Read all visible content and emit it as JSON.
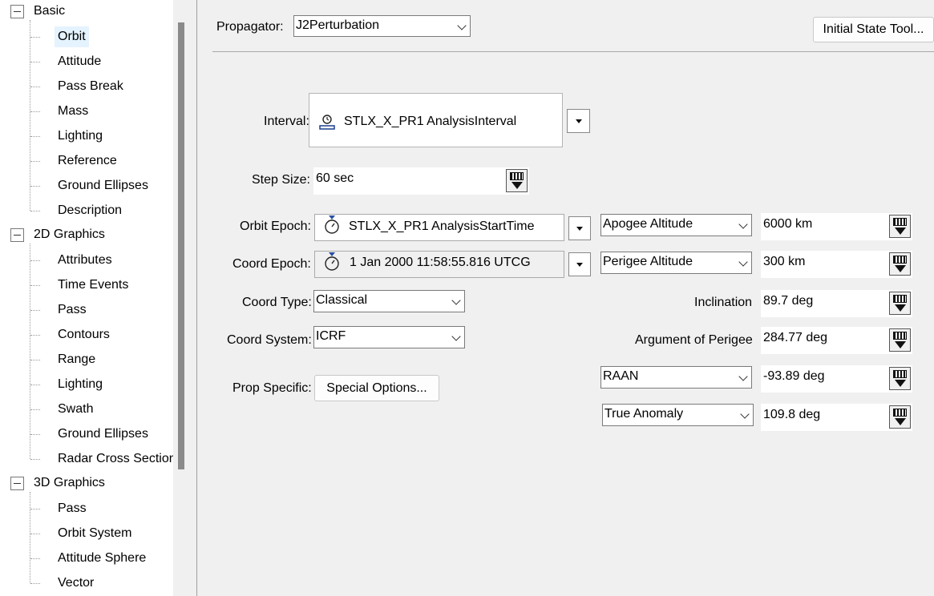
{
  "tree": {
    "groups": [
      {
        "label": "Basic",
        "items": [
          "Orbit",
          "Attitude",
          "Pass Break",
          "Mass",
          "Lighting",
          "Reference",
          "Ground Ellipses",
          "Description"
        ]
      },
      {
        "label": "2D Graphics",
        "items": [
          "Attributes",
          "Time Events",
          "Pass",
          "Contours",
          "Range",
          "Lighting",
          "Swath",
          "Ground Ellipses",
          "Radar Cross Section"
        ]
      },
      {
        "label": "3D Graphics",
        "items": [
          "Pass",
          "Orbit System",
          "Attitude Sphere",
          "Vector"
        ]
      }
    ],
    "selected": "Orbit"
  },
  "propagator": {
    "label": "Propagator:",
    "value": "J2Perturbation"
  },
  "initial_state_button": "Initial State Tool...",
  "interval": {
    "label": "Interval:",
    "value": "STLX_X_PR1 AnalysisInterval"
  },
  "step_size": {
    "label": "Step Size:",
    "value": "60 sec"
  },
  "orbit_epoch": {
    "label": "Orbit Epoch:",
    "value": "STLX_X_PR1 AnalysisStartTime"
  },
  "coord_epoch": {
    "label": "Coord Epoch:",
    "value": "1 Jan 2000 11:58:55.816 UTCG"
  },
  "coord_type": {
    "label": "Coord Type:",
    "value": "Classical"
  },
  "coord_system": {
    "label": "Coord System:",
    "value": "ICRF"
  },
  "prop_specific": {
    "label": "Prop Specific:",
    "button": "Special Options..."
  },
  "elements": {
    "apogee": {
      "label": "Apogee Altitude",
      "value": "6000 km"
    },
    "perigee": {
      "label": "Perigee Altitude",
      "value": "300 km"
    },
    "inclination": {
      "label": "Inclination",
      "value": "89.7 deg"
    },
    "arg_perigee": {
      "label": "Argument of Perigee",
      "value": "284.77 deg"
    },
    "raan": {
      "label": "RAAN",
      "value": "-93.89 deg"
    },
    "true_anomaly": {
      "label": "True Anomaly",
      "value": "109.8 deg"
    }
  }
}
